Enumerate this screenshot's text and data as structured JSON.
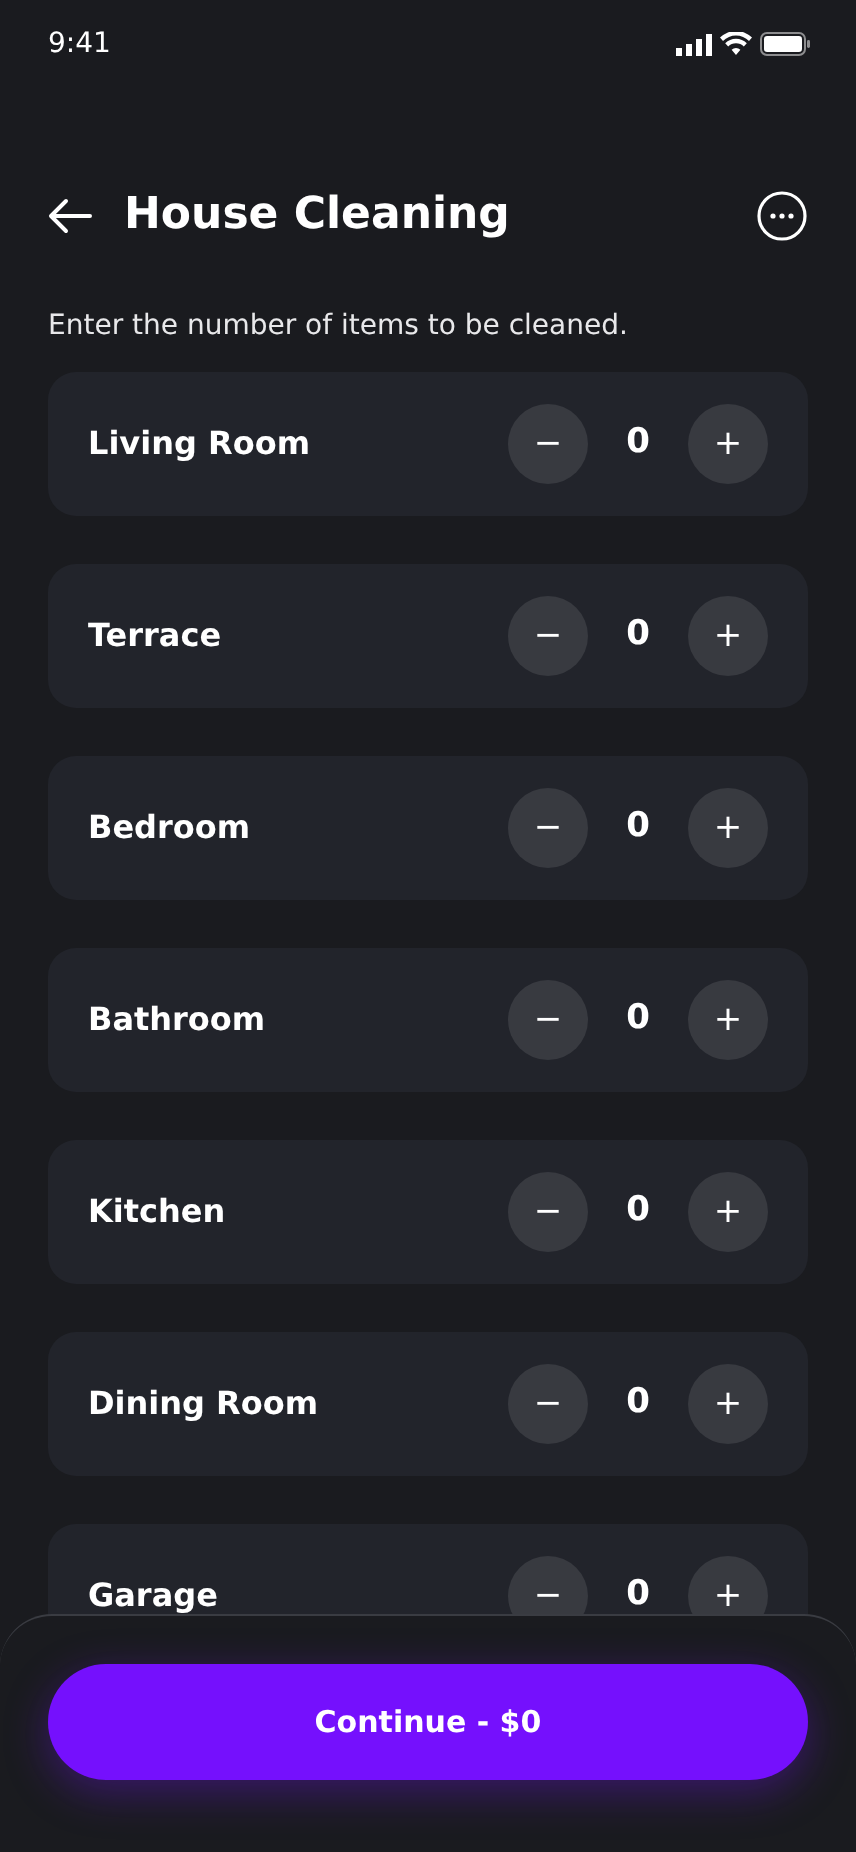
{
  "status_bar": {
    "time": "9:41"
  },
  "header": {
    "title": "House Cleaning"
  },
  "instruction": "Enter the number of items to be cleaned.",
  "items": [
    {
      "name": "Living Room",
      "count": "0",
      "decrement": "−",
      "increment": "+"
    },
    {
      "name": "Terrace",
      "count": "0",
      "decrement": "−",
      "increment": "+"
    },
    {
      "name": "Bedroom",
      "count": "0",
      "decrement": "−",
      "increment": "+"
    },
    {
      "name": "Bathroom",
      "count": "0",
      "decrement": "−",
      "increment": "+"
    },
    {
      "name": "Kitchen",
      "count": "0",
      "decrement": "−",
      "increment": "+"
    },
    {
      "name": "Dining Room",
      "count": "0",
      "decrement": "−",
      "increment": "+"
    },
    {
      "name": "Garage",
      "count": "0",
      "decrement": "−",
      "increment": "+"
    }
  ],
  "continue_button": "Continue - $0"
}
